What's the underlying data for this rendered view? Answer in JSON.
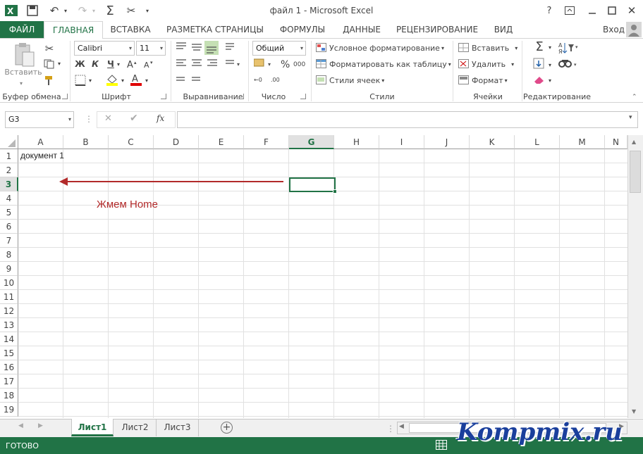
{
  "window": {
    "title": "файл 1 - Microsoft Excel",
    "user": "Вход"
  },
  "tabs": [
    {
      "label": "ФАЙЛ"
    },
    {
      "label": "ГЛАВНАЯ"
    },
    {
      "label": "ВСТАВКА"
    },
    {
      "label": "РАЗМЕТКА СТРАНИЦЫ"
    },
    {
      "label": "ФОРМУЛЫ"
    },
    {
      "label": "ДАННЫЕ"
    },
    {
      "label": "РЕЦЕНЗИРОВАНИЕ"
    },
    {
      "label": "ВИД"
    }
  ],
  "ribbon": {
    "clipboard": {
      "paste": "Вставить",
      "group": "Буфер обмена"
    },
    "font": {
      "name": "Calibri",
      "size": "11",
      "bold": "Ж",
      "italic": "К",
      "underline": "Ч",
      "group": "Шрифт"
    },
    "alignment": {
      "group": "Выравнивание"
    },
    "number": {
      "format": "Общий",
      "group": "Число"
    },
    "styles": {
      "conditional": "Условное форматирование",
      "table": "Форматировать как таблицу",
      "cell": "Стили ячеек",
      "group": "Стили"
    },
    "cells": {
      "insert": "Вставить",
      "delete": "Удалить",
      "format": "Формат",
      "group": "Ячейки"
    },
    "editing": {
      "group": "Редактирование"
    }
  },
  "formula_bar": {
    "name_box": "G3",
    "fx": "fx",
    "value": ""
  },
  "columns": [
    "A",
    "B",
    "C",
    "D",
    "E",
    "F",
    "G",
    "H",
    "I",
    "J",
    "K",
    "L",
    "M",
    "N"
  ],
  "rows": [
    "1",
    "2",
    "3",
    "4",
    "5",
    "6",
    "7",
    "8",
    "9",
    "10",
    "11",
    "12",
    "13",
    "14",
    "15",
    "16",
    "17",
    "18",
    "19"
  ],
  "cells": {
    "A1": "документ 1"
  },
  "annotation": {
    "text": "Жмем Home",
    "color": "#b22a2a"
  },
  "sheets": [
    {
      "label": "Лист1"
    },
    {
      "label": "Лист2"
    },
    {
      "label": "Лист3"
    }
  ],
  "status": {
    "text": "ГОТОВО"
  },
  "watermark": {
    "text": "Kompmix.ru"
  },
  "colors": {
    "accent": "#217346",
    "selection": "#217346",
    "arrow": "#b22a2a"
  }
}
